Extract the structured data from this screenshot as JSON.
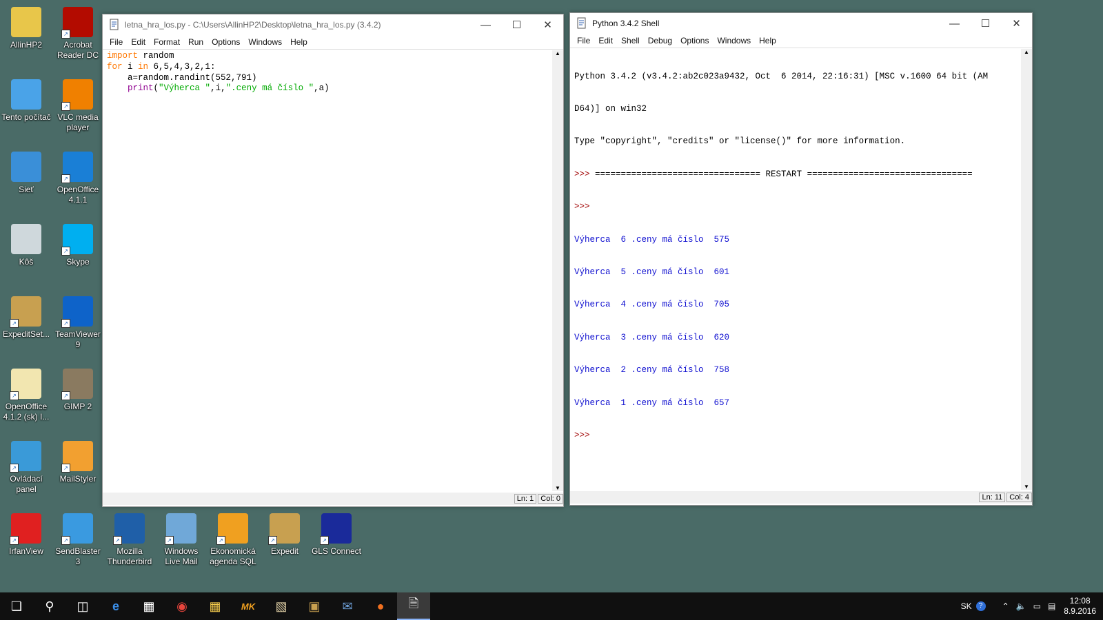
{
  "desktop": {
    "icons": [
      {
        "label": "AllinHP2",
        "icon": "user-folder-icon",
        "color": "#e8c64a"
      },
      {
        "label": "Acrobat Reader DC",
        "icon": "acrobat-icon",
        "color": "#b30b00"
      },
      {
        "label": "Tento počítač",
        "icon": "computer-icon",
        "color": "#4aa3e8"
      },
      {
        "label": "VLC media player",
        "icon": "vlc-icon",
        "color": "#f08000"
      },
      {
        "label": "Sieť",
        "icon": "network-icon",
        "color": "#3a8fd8"
      },
      {
        "label": "OpenOffice 4.1.1",
        "icon": "openoffice-icon",
        "color": "#1a7fd6"
      },
      {
        "label": "Kôš",
        "icon": "recycle-bin-icon",
        "color": "#cfd8dc"
      },
      {
        "label": "Skype",
        "icon": "skype-icon",
        "color": "#00aff0"
      },
      {
        "label": "ExpeditSet...",
        "icon": "package-icon",
        "color": "#c8a050"
      },
      {
        "label": "TeamViewer 9",
        "icon": "teamviewer-icon",
        "color": "#0e63c9"
      },
      {
        "label": "OpenOffice 4.1.2 (sk) I...",
        "icon": "folder-icon",
        "color": "#f2e6b0"
      },
      {
        "label": "GIMP 2",
        "icon": "gimp-icon",
        "color": "#8a7a60"
      },
      {
        "label": "Ovládací panel",
        "icon": "control-panel-icon",
        "color": "#3a9ad8"
      },
      {
        "label": "MailStyler",
        "icon": "mailstyler-icon",
        "color": "#f2a030"
      },
      {
        "label": "IrfanView",
        "icon": "irfanview-icon",
        "color": "#e02020"
      },
      {
        "label": "SendBlaster 3",
        "icon": "sendblaster-icon",
        "color": "#3a9ae0"
      },
      {
        "label": "Mozilla Thunderbird",
        "icon": "thunderbird-icon",
        "color": "#1f5fa8"
      },
      {
        "label": "Windows Live Mail",
        "icon": "live-mail-icon",
        "color": "#70a8d8"
      },
      {
        "label": "Ekonomická agenda SQL",
        "icon": "mk-sql-icon",
        "color": "#f0a020"
      },
      {
        "label": "Expedit",
        "icon": "package-icon",
        "color": "#c8a050"
      },
      {
        "label": "GLS Connect",
        "icon": "gls-icon",
        "color": "#1a2a9a"
      }
    ]
  },
  "editor": {
    "title": "letna_hra_los.py - C:\\Users\\AllinHP2\\Desktop\\letna_hra_los.py (3.4.2)",
    "menu": [
      "File",
      "Edit",
      "Format",
      "Run",
      "Options",
      "Windows",
      "Help"
    ],
    "code": {
      "l1_kw": "import",
      "l1_rest": " random",
      "l2_kw": "for",
      "l2_mid": " i ",
      "l2_kw2": "in",
      "l2_rest": " 6,5,4,3,2,1:",
      "l3": "    a=random.randint(552,791)",
      "l4_indent": "    ",
      "l4_bi": "print",
      "l4_open": "(",
      "l4_s1": "\"Výherca \"",
      "l4_mid": ",i,",
      "l4_s2": "\".ceny má číslo \"",
      "l4_rest": ",a)"
    },
    "status": {
      "ln": "Ln: 1",
      "col": "Col: 0"
    }
  },
  "shell": {
    "title": "Python 3.4.2 Shell",
    "menu": [
      "File",
      "Edit",
      "Shell",
      "Debug",
      "Options",
      "Windows",
      "Help"
    ],
    "header": [
      "Python 3.4.2 (v3.4.2:ab2c023a9432, Oct  6 2014, 22:16:31) [MSC v.1600 64 bit (AM",
      "D64)] on win32",
      "Type \"copyright\", \"credits\" or \"license()\" for more information."
    ],
    "restart_prompt": ">>> ",
    "restart_line": "================================ RESTART ================================",
    "prompt": ">>>",
    "output": [
      "Výherca  6 .ceny má číslo  575",
      "Výherca  5 .ceny má číslo  601",
      "Výherca  4 .ceny má číslo  705",
      "Výherca  3 .ceny má číslo  620",
      "Výherca  2 .ceny má číslo  758",
      "Výherca  1 .ceny má číslo  657"
    ],
    "status": {
      "ln": "Ln: 11",
      "col": "Col: 4"
    }
  },
  "taskbar": {
    "tray_lang": "SK",
    "time": "12:08",
    "date": "8.9.2016",
    "icons": [
      "start-icon",
      "search-icon",
      "task-view-icon",
      "edge-icon",
      "store-icon",
      "chrome-icon",
      "file-explorer-icon",
      "mk-icon",
      "app-icon",
      "package-icon",
      "thunderbird-icon",
      "firefox-icon",
      "idle-icon"
    ]
  }
}
